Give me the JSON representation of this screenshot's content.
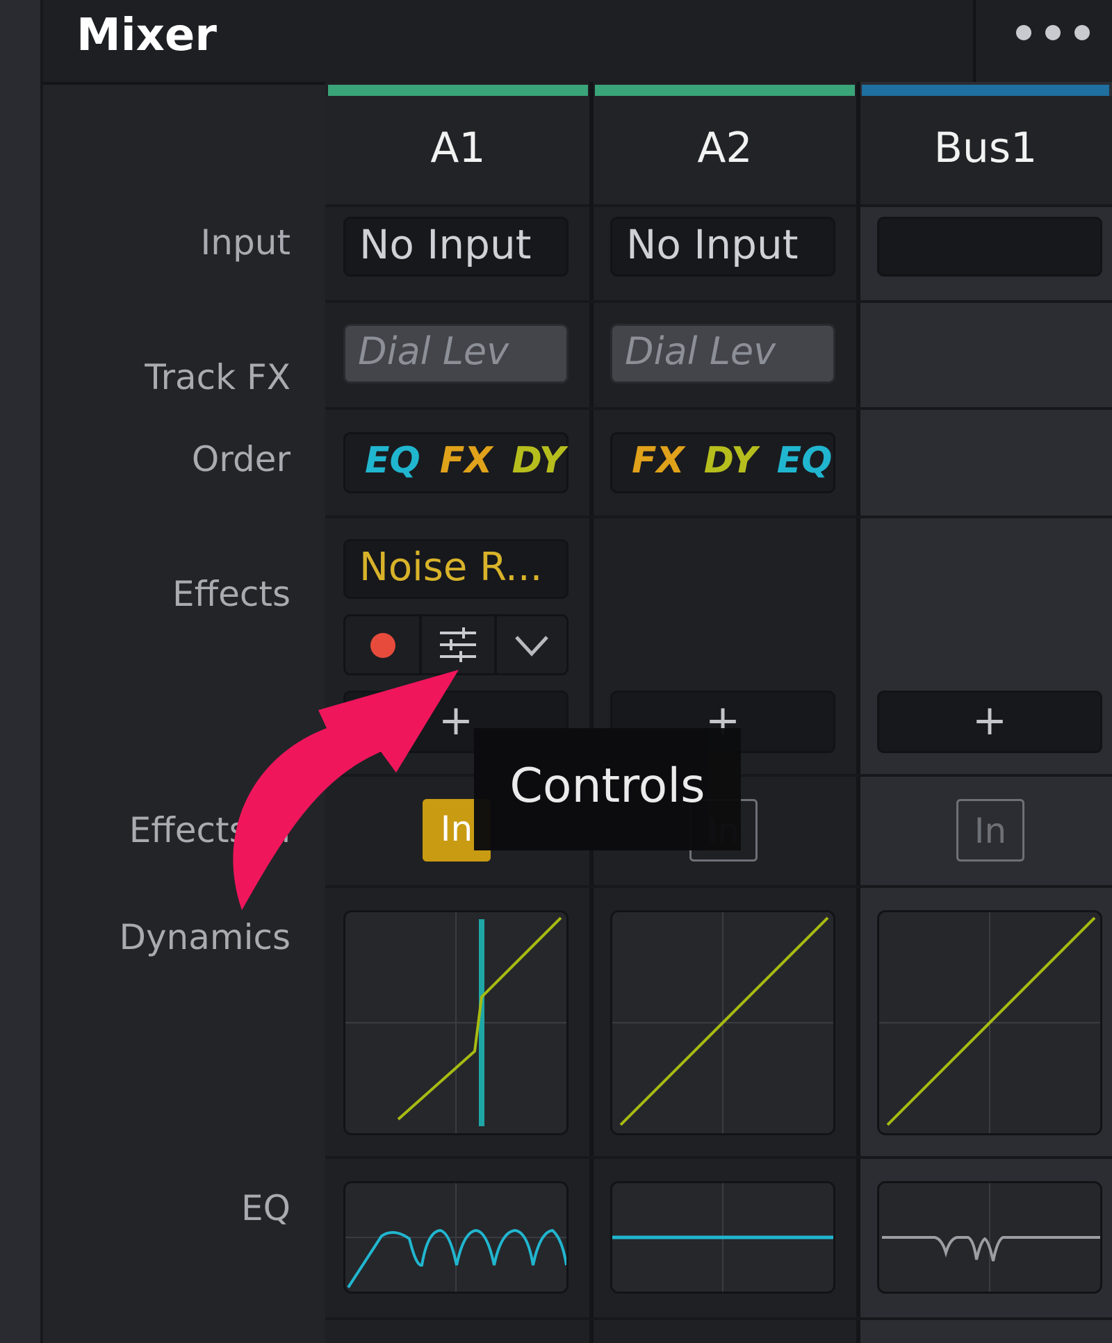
{
  "window": {
    "title": "Mixer"
  },
  "labels": {
    "input": "Input",
    "track_fx": "Track FX",
    "order": "Order",
    "effects": "Effects",
    "effects_in": "Effects In",
    "dynamics": "Dynamics",
    "eq": "EQ"
  },
  "tracks": [
    {
      "name": "A1",
      "color": "#3ba57a",
      "input": "No Input",
      "track_fx": "Dial Lev",
      "order": [
        "EQ",
        "FX",
        "DY"
      ],
      "effect": "Noise R...",
      "effects_in": "In",
      "effects_in_active": true
    },
    {
      "name": "A2",
      "color": "#3ba57a",
      "input": "No Input",
      "track_fx": "Dial Lev",
      "order": [
        "FX",
        "DY",
        "EQ"
      ],
      "effects_in": "In",
      "effects_in_active": false
    },
    {
      "name": "Bus1",
      "color": "#1f6fa0",
      "input": "",
      "effects_in": "In",
      "effects_in_active": false
    }
  ],
  "add_effect_label": "+",
  "tooltip": {
    "text": "Controls"
  },
  "icons": {
    "more": "more-options-icon",
    "record": "record-dot-icon",
    "controls": "sliders-icon",
    "expand": "chevron-down-icon",
    "annotation": "curved-arrow-icon"
  },
  "colors": {
    "eq": "#21b6cf",
    "fx": "#e0a21a",
    "dy": "#b6be1d",
    "effects_in_active": "#c89b12",
    "arrow": "#f0165c"
  }
}
